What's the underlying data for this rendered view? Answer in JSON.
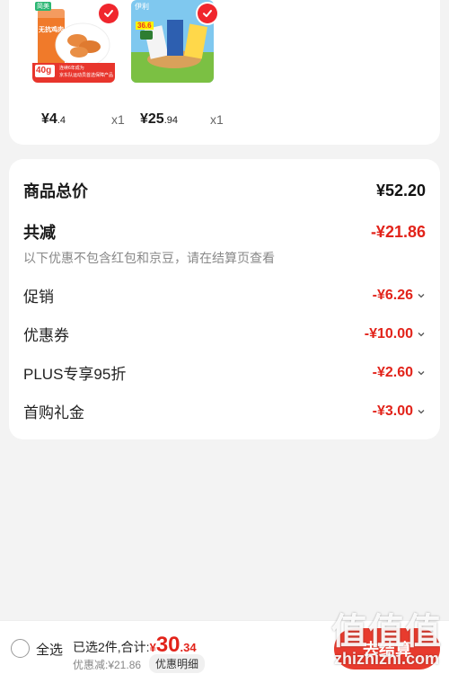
{
  "products": [
    {
      "price_symbol": "¥",
      "price_int": "4",
      "price_dec": ".4",
      "qty": "x1",
      "thumb_texts": {
        "brand": "简美",
        "title": "无抗鸡肉",
        "weight": "40g",
        "promo_line1": "连续6年成为",
        "promo_line2": "京东队运动员首选保障产品"
      }
    },
    {
      "price_symbol": "¥",
      "price_int": "25",
      "price_dec": ".94",
      "qty": "x1",
      "thumb_texts": {
        "brand": "伊利",
        "badge": "36.6"
      }
    }
  ],
  "summary": {
    "total_label": "商品总价",
    "total_value": "¥52.20",
    "reduce_label": "共减",
    "reduce_value": "-¥21.86",
    "note": "以下优惠不包含红包和京豆，请在结算页查看",
    "items": [
      {
        "label": "促销",
        "value": "-¥6.26"
      },
      {
        "label": "优惠券",
        "value": "-¥10.00"
      },
      {
        "label": "PLUS专享95折",
        "value": "-¥2.60"
      },
      {
        "label": "首购礼金",
        "value": "-¥3.00"
      }
    ]
  },
  "bottom": {
    "select_all": "全选",
    "selected_text": "已选2件,合计:",
    "total_symbol": "¥",
    "total_int": "30",
    "total_dec": ".34",
    "discount_text": "优惠减:¥21.86",
    "detail_btn": "优惠明细",
    "checkout_btn": "去结算"
  },
  "watermark": {
    "chars": "值值值",
    "url": "zhizhizhi.com"
  },
  "colors": {
    "accent_red": "#e2231a",
    "check_red": "#f0262d",
    "checkout_red": "#e83b2e"
  }
}
